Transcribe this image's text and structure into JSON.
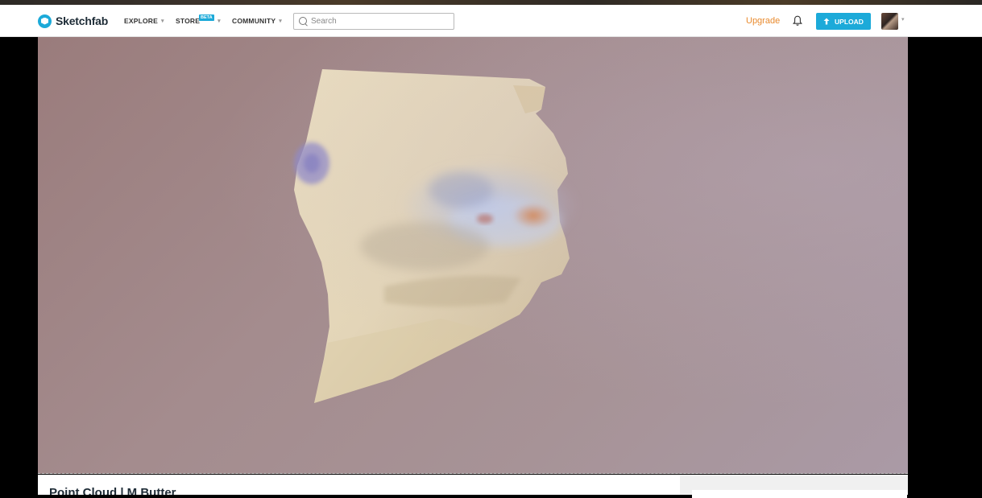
{
  "brand": {
    "name": "Sketchfab",
    "accent": "#1caad9",
    "upgrade_color": "#e98a2d"
  },
  "nav": {
    "explore": "EXPLORE",
    "store": "STORE",
    "store_badge": "BETA",
    "community": "COMMUNITY"
  },
  "search": {
    "placeholder": "Search",
    "value": ""
  },
  "header": {
    "upgrade": "Upgrade",
    "upload": "UPLOAD",
    "notifications_icon": "bell-icon",
    "upload_icon": "arrow-up-icon"
  },
  "model": {
    "title": "Point Cloud | M Butter"
  }
}
